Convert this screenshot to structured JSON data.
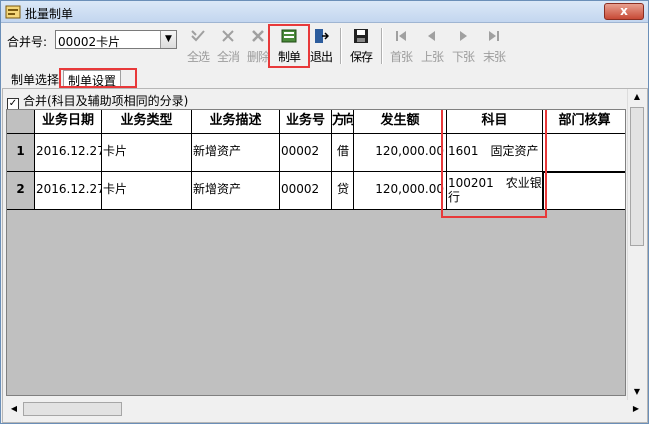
{
  "window": {
    "title": "批量制单",
    "close_label": "x"
  },
  "toolbar": {
    "merge_label": "合并号:",
    "merge_value": "00002卡片",
    "buttons": [
      {
        "label": "全选",
        "enabled": false,
        "icon": "select-all-icon"
      },
      {
        "label": "全消",
        "enabled": false,
        "icon": "deselect-all-icon"
      },
      {
        "label": "删除",
        "enabled": false,
        "icon": "delete-icon"
      },
      {
        "label": "制单",
        "enabled": true,
        "icon": "voucher-icon"
      },
      {
        "label": "退出",
        "enabled": true,
        "icon": "exit-icon"
      },
      {
        "label": "保存",
        "enabled": true,
        "icon": "save-icon"
      },
      {
        "label": "首张",
        "enabled": false,
        "icon": "first-icon"
      },
      {
        "label": "上张",
        "enabled": false,
        "icon": "prev-icon"
      },
      {
        "label": "下张",
        "enabled": false,
        "icon": "next-icon"
      },
      {
        "label": "末张",
        "enabled": false,
        "icon": "last-icon"
      }
    ]
  },
  "tabs": [
    {
      "label": "制单选择",
      "active": false
    },
    {
      "label": "制单设置",
      "active": true
    }
  ],
  "options": {
    "merge_checkbox_label": "合并(科目及辅助项相同的分录)",
    "merge_checked": true
  },
  "grid": {
    "columns": [
      "业务日期",
      "业务类型",
      "业务描述",
      "业务号",
      "方向",
      "发生额",
      "科目",
      "部门核算"
    ],
    "rows": [
      {
        "num": "1",
        "date": "2016.12.27",
        "type": "卡片",
        "desc": "新增资产",
        "bizno": "00002",
        "dir": "借",
        "amount": "120,000.00",
        "subject": "1601　固定资产",
        "dept": ""
      },
      {
        "num": "2",
        "date": "2016.12.27",
        "type": "卡片",
        "desc": "新增资产",
        "bizno": "00002",
        "dir": "贷",
        "amount": "120,000.00",
        "subject": "100201　农业银行",
        "dept": ""
      }
    ]
  },
  "colors": {
    "highlight": "#e8393a",
    "grid_background": "#c0c0c0"
  }
}
